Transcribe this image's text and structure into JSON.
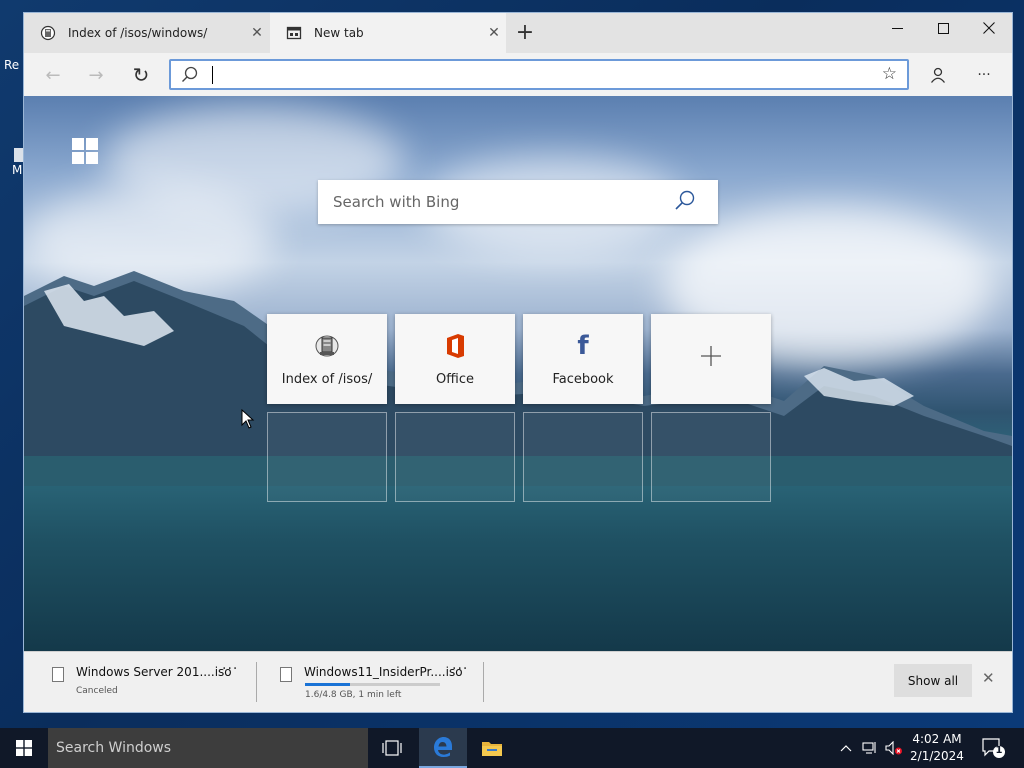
{
  "desktop": {
    "icons": [
      {
        "label": "Re"
      },
      {
        "label": "M"
      }
    ]
  },
  "browser": {
    "tabs": [
      {
        "label": "Index of /isos/windows/",
        "icon": "globe-server-icon",
        "close": "✕"
      },
      {
        "label": "New tab",
        "icon": "newtab-page-icon",
        "close": "✕"
      }
    ],
    "new_tab_symbol": "+",
    "window_controls": {
      "minimize": "—",
      "maximize": "☐",
      "close": "✕"
    },
    "toolbar": {
      "back": "←",
      "forward": "→",
      "refresh": "↻",
      "address_value": "",
      "favorite": "☆",
      "more": "···"
    }
  },
  "newtab": {
    "search_placeholder": "Search with Bing",
    "tiles": [
      {
        "label": "Index of /isos/",
        "icon": "server-icon"
      },
      {
        "label": "Office",
        "icon": "office-icon"
      },
      {
        "label": "Facebook",
        "icon": "facebook-icon",
        "glyph": "f"
      },
      {
        "label": "",
        "icon": "add-icon",
        "glyph": "+"
      }
    ]
  },
  "downloads": {
    "items": [
      {
        "name": "Windows Server 201....iso",
        "status": "Canceled",
        "more": "···"
      },
      {
        "name": "Windows11_InsiderPr....iso",
        "status": "1.6/4.8 GB, 1 min left",
        "more": "···",
        "progress": 0.33
      }
    ],
    "show_all": "Show all",
    "close": "✕"
  },
  "taskbar": {
    "search_placeholder": "Search Windows",
    "time": "4:02 AM",
    "date": "2/1/2024",
    "notification_count": "1",
    "tray_chevron": "^"
  },
  "colors": {
    "accent": "#1a73d6",
    "office_red": "#d83b01",
    "facebook_blue": "#3b5998",
    "edge_blue": "#2a7ad8"
  }
}
